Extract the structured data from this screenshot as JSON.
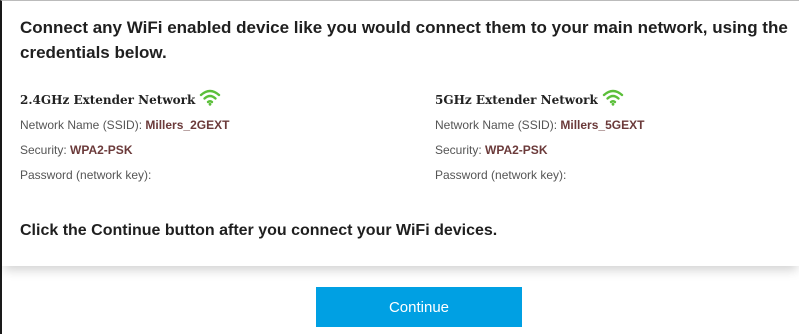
{
  "intro_text": "Connect any WiFi enabled device like you would connect them to your main network, using the credentials below.",
  "networks": [
    {
      "title": "2.4GHz Extender Network",
      "ssid_label": "Network Name (SSID):",
      "ssid": "Millers_2GEXT",
      "security_label": "Security:",
      "security": "WPA2-PSK",
      "password_label": "Password (network key):"
    },
    {
      "title": "5GHz Extender Network",
      "ssid_label": "Network Name (SSID):",
      "ssid": "Millers_5GEXT",
      "security_label": "Security:",
      "security": "WPA2-PSK",
      "password_label": "Password (network key):"
    }
  ],
  "cta_note": "Click the Continue button after you connect your WiFi devices.",
  "continue_label": "Continue",
  "colors": {
    "accent": "#00a0e3",
    "wifi_icon": "#5bbf3a",
    "value_text": "#6b3a3a"
  },
  "icons": [
    "wifi-signal-icon"
  ]
}
